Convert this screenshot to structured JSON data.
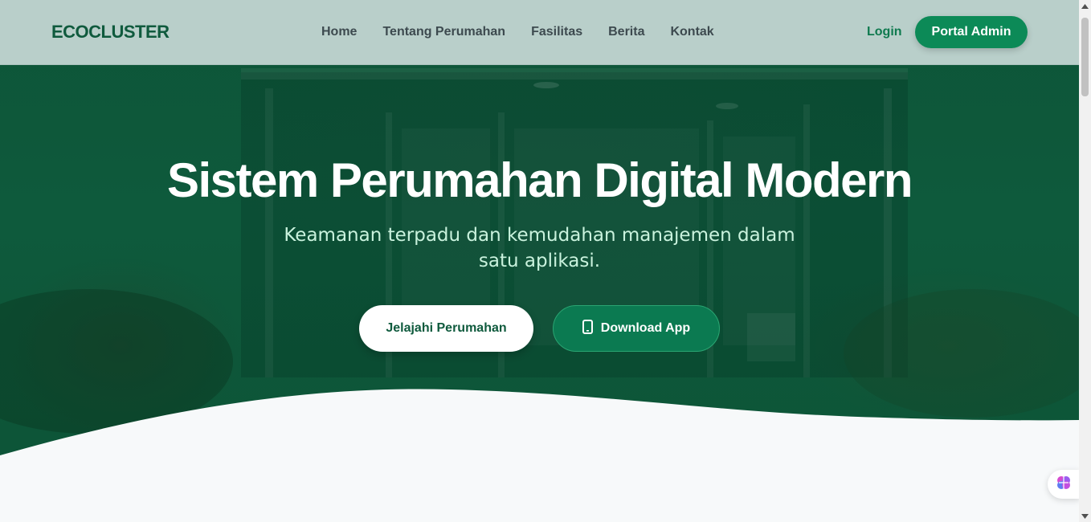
{
  "brand": "ECOCLUSTER",
  "nav": {
    "links": [
      "Home",
      "Tentang Perumahan",
      "Fasilitas",
      "Berita",
      "Kontak"
    ],
    "login": "Login",
    "portal": "Portal Admin"
  },
  "hero": {
    "title": "Sistem Perumahan Digital Modern",
    "subtitle": "Keamanan terpadu dan kemudahan manajemen dalam satu aplikasi.",
    "explore_button": "Jelajahi Perumahan",
    "download_button": "Download App"
  },
  "icons": {
    "phone": "mobile-phone-icon",
    "widget": "brain-icon"
  },
  "colors": {
    "brand": "#0f5a3d",
    "hero_bg": "#0d5538",
    "accent": "#0c8a57",
    "navbar_bg": "#b9cfca",
    "subtitle": "#c9f2dd"
  }
}
